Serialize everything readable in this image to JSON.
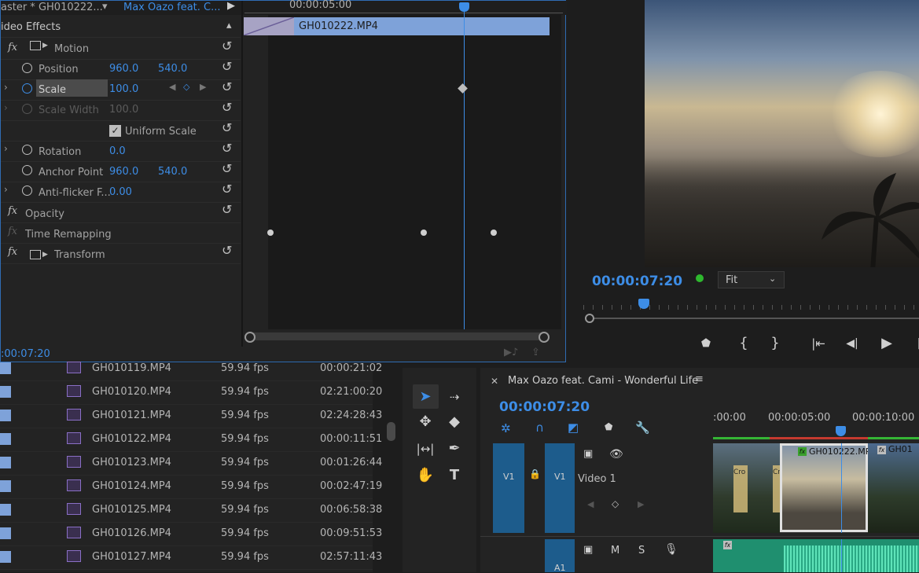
{
  "effect_controls": {
    "tab_master": "aster * GH010222...",
    "tab_sequence": "Max Oazo feat. C...",
    "section": "ideo Effects",
    "ruler_time": "00:00:05:00",
    "clip_name": "GH010222.MP4",
    "current_time": ":00:07:20",
    "rows": {
      "motion": "Motion",
      "position": "Position",
      "position_x": "960.0",
      "position_y": "540.0",
      "scale": "Scale",
      "scale_val": "100.0",
      "scale_width": "Scale Width",
      "scale_width_val": "100.0",
      "uniform_scale": "Uniform Scale",
      "rotation": "Rotation",
      "rotation_val": "0.0",
      "anchor": "Anchor Point",
      "anchor_x": "960.0",
      "anchor_y": "540.0",
      "antiflicker": "Anti-flicker F...",
      "antiflicker_val": "0.00",
      "opacity": "Opacity",
      "time_remap": "Time Remapping",
      "transform": "Transform"
    },
    "fx": "fx"
  },
  "program_monitor": {
    "timecode": "00:00:07:20",
    "fit": "Fit"
  },
  "project": {
    "rows": [
      {
        "name": "GH010119.MP4",
        "fps": "59.94 fps",
        "dur": "00:00:21:02"
      },
      {
        "name": "GH010120.MP4",
        "fps": "59.94 fps",
        "dur": "02:21:00:20"
      },
      {
        "name": "GH010121.MP4",
        "fps": "59.94 fps",
        "dur": "02:24:28:43"
      },
      {
        "name": "GH010122.MP4",
        "fps": "59.94 fps",
        "dur": "00:00:11:51"
      },
      {
        "name": "GH010123.MP4",
        "fps": "59.94 fps",
        "dur": "00:01:26:44"
      },
      {
        "name": "GH010124.MP4",
        "fps": "59.94 fps",
        "dur": "00:02:47:19"
      },
      {
        "name": "GH010125.MP4",
        "fps": "59.94 fps",
        "dur": "00:06:58:38"
      },
      {
        "name": "GH010126.MP4",
        "fps": "59.94 fps",
        "dur": "00:09:51:53"
      },
      {
        "name": "GH010127.MP4",
        "fps": "59.94 fps",
        "dur": "02:57:11:43"
      }
    ]
  },
  "sequence": {
    "title": "Max Oazo feat. Cami - Wonderful Life",
    "timecode": "00:00:07:20",
    "ruler": [
      ":00:00",
      "00:00:05:00",
      "00:00:10:00"
    ],
    "v1_left": "V1",
    "v1_right": "V1",
    "video1": "Video 1",
    "a1": "A1",
    "m": "M",
    "s": "S",
    "clip_a": "GH010222.MP4",
    "clip_b": "GH01",
    "cross1": "Cro",
    "cross2": "Cro",
    "fx": "fx"
  }
}
